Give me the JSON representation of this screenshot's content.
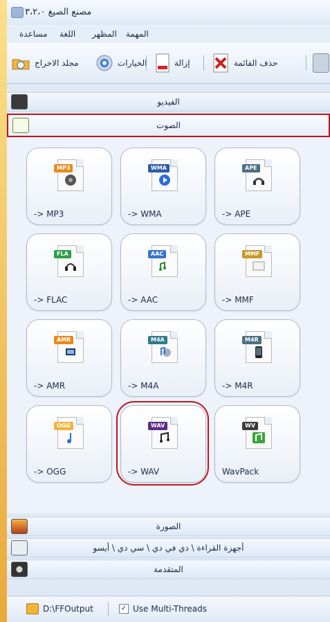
{
  "window": {
    "title": "مصنع الصيغ ٣،٢،٠"
  },
  "menu": {
    "items": [
      "مساعدة",
      "اللغة",
      "المظهر",
      "المهمة"
    ]
  },
  "toolbar": {
    "output_folder_label": "مجلد الاخراج",
    "options_label": "الخيارات",
    "remove_label": "إزالة",
    "clear_list_label": "حذف القائمة"
  },
  "categories": {
    "video": "الفيديو",
    "audio": "الصوت",
    "picture": "الصورة",
    "rom": "أجهزة القراءة \\ دي في دي \\ سي دي \\ أيسو",
    "advanced": "المتقدمة"
  },
  "tiles": [
    {
      "label": "-> MP3",
      "badge": "MP3"
    },
    {
      "label": "-> WMA",
      "badge": "WMA"
    },
    {
      "label": "-> APE",
      "badge": "APE"
    },
    {
      "label": "-> FLAC",
      "badge": "FLA"
    },
    {
      "label": "-> AAC",
      "badge": "AAC"
    },
    {
      "label": "-> MMF",
      "badge": "MMF"
    },
    {
      "label": "-> AMR",
      "badge": "AMR"
    },
    {
      "label": "-> M4A",
      "badge": "M4A"
    },
    {
      "label": "-> M4R",
      "badge": "M4R"
    },
    {
      "label": "-> OGG",
      "badge": "OGG"
    },
    {
      "label": "-> WAV",
      "badge": "WAV"
    },
    {
      "label": "WavPack",
      "badge": "WV"
    }
  ],
  "status": {
    "output_path": "D:\\FFOutput",
    "multithread_label": "Use Multi-Threads",
    "multithread_checked": true
  }
}
